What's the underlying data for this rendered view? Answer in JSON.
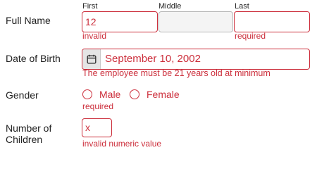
{
  "full_name": {
    "label": "Full Name",
    "first": {
      "label": "First",
      "value": "12",
      "error": "invalid"
    },
    "middle": {
      "label": "Middle",
      "value": ""
    },
    "last": {
      "label": "Last",
      "value": "",
      "error": "required"
    }
  },
  "date_of_birth": {
    "label": "Date of Birth",
    "value": "September 10, 2002",
    "icon": "calendar-icon",
    "error": "The employee must be 21 years old at minimum"
  },
  "gender": {
    "label": "Gender",
    "options": [
      "Male",
      "Female"
    ],
    "error": "required"
  },
  "children": {
    "label_line1": "Number of",
    "label_line2": "Children",
    "value": "x",
    "error": "invalid numeric value"
  },
  "colors": {
    "error": "#cc2e3b",
    "text": "#222222",
    "disabled_bg": "#f4f4f4"
  }
}
